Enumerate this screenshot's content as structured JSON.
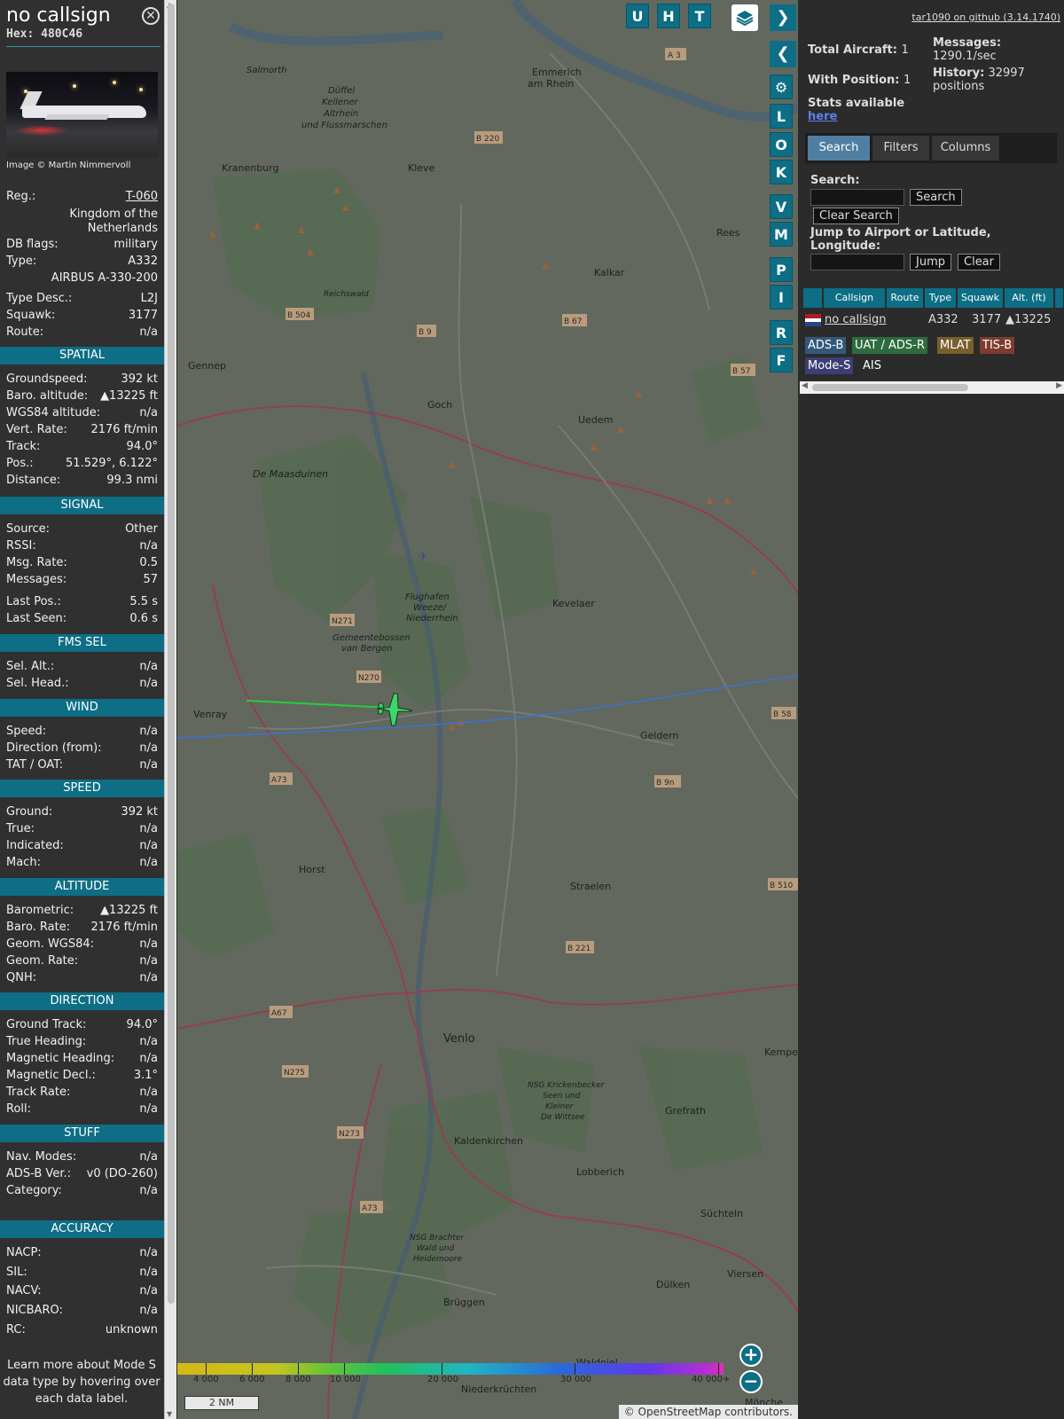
{
  "info": {
    "callsign": "no callsign",
    "hex": "Hex: 480C46",
    "close_icon": "close-icon",
    "photo_credit": "Image © Martin Nimmervoll",
    "header_fields": [
      {
        "label": "Reg.:",
        "value": "T-060"
      },
      {
        "label": "DB flags:",
        "value": "military"
      },
      {
        "label": "Type:",
        "value": "A332"
      },
      {
        "label": "Type Desc.:",
        "value": "L2J"
      },
      {
        "label": "Squawk:",
        "value": "3177"
      },
      {
        "label": "Route:",
        "value": "n/a"
      }
    ],
    "country_line1": "Kingdom of the",
    "country_line2": "Netherlands",
    "type_full": "AIRBUS A-330-200",
    "sections": {
      "spatial": {
        "title": "SPATIAL",
        "rows": [
          {
            "label": "Groundspeed:",
            "value": "392 kt"
          },
          {
            "label": "Baro. altitude:",
            "value": "▲13225 ft"
          },
          {
            "label": "WGS84 altitude:",
            "value": "n/a"
          },
          {
            "label": "Vert. Rate:",
            "value": "2176 ft/min"
          },
          {
            "label": "Track:",
            "value": "94.0°"
          },
          {
            "label": "Pos.:",
            "value": "51.529°, 6.122°"
          },
          {
            "label": "Distance:",
            "value": "99.3 nmi"
          }
        ]
      },
      "signal": {
        "title": "SIGNAL",
        "rows": [
          {
            "label": "Source:",
            "value": "Other"
          },
          {
            "label": "RSSI:",
            "value": "n/a"
          },
          {
            "label": "Msg. Rate:",
            "value": "0.5"
          },
          {
            "label": "Messages:",
            "value": "57"
          },
          {
            "label": "Last Pos.:",
            "value": "5.5 s"
          },
          {
            "label": "Last Seen:",
            "value": "0.6 s"
          }
        ]
      },
      "fms": {
        "title": "FMS SEL",
        "rows": [
          {
            "label": "Sel. Alt.:",
            "value": "n/a"
          },
          {
            "label": "Sel. Head.:",
            "value": "n/a"
          }
        ]
      },
      "wind": {
        "title": "WIND",
        "rows": [
          {
            "label": "Speed:",
            "value": "n/a"
          },
          {
            "label": "Direction (from):",
            "value": "n/a"
          },
          {
            "label": "TAT / OAT:",
            "value": "n/a"
          }
        ]
      },
      "speed": {
        "title": "SPEED",
        "rows": [
          {
            "label": "Ground:",
            "value": "392 kt"
          },
          {
            "label": "True:",
            "value": "n/a"
          },
          {
            "label": "Indicated:",
            "value": "n/a"
          },
          {
            "label": "Mach:",
            "value": "n/a"
          }
        ]
      },
      "altitude": {
        "title": "ALTITUDE",
        "rows": [
          {
            "label": "Barometric:",
            "value": "▲13225 ft"
          },
          {
            "label": "Baro. Rate:",
            "value": "2176 ft/min"
          },
          {
            "label": "Geom. WGS84:",
            "value": "n/a"
          },
          {
            "label": "Geom. Rate:",
            "value": "n/a"
          },
          {
            "label": "QNH:",
            "value": "n/a"
          }
        ]
      },
      "direction": {
        "title": "DIRECTION",
        "rows": [
          {
            "label": "Ground Track:",
            "value": "94.0°"
          },
          {
            "label": "True Heading:",
            "value": "n/a"
          },
          {
            "label": "Magnetic Heading:",
            "value": "n/a"
          },
          {
            "label": "Magnetic Decl.:",
            "value": "3.1°"
          },
          {
            "label": "Track Rate:",
            "value": "n/a"
          },
          {
            "label": "Roll:",
            "value": "n/a"
          }
        ]
      },
      "stuff": {
        "title": "STUFF",
        "rows": [
          {
            "label": "Nav. Modes:",
            "value": "n/a"
          },
          {
            "label": "ADS-B Ver.:",
            "value": "v0 (DO-260)"
          },
          {
            "label": "Category:",
            "value": "n/a"
          }
        ]
      },
      "accuracy": {
        "title": "ACCURACY",
        "rows": [
          {
            "label": "NACP:",
            "value": "n/a"
          },
          {
            "label": "SIL:",
            "value": "n/a"
          },
          {
            "label": "NACV:",
            "value": "n/a"
          },
          {
            "label": "NICBARO:",
            "value": "n/a"
          },
          {
            "label": "RC:",
            "value": "unknown"
          }
        ]
      }
    },
    "footnote": "Learn more about Mode S data type by hovering over each data label."
  },
  "map": {
    "buttons_top": [
      "U",
      "H",
      "T"
    ],
    "buttons_side": [
      "L",
      "O",
      "K",
      "V",
      "M",
      "P",
      "I",
      "R",
      "F"
    ],
    "layers_icon": "layers-icon",
    "settings_icon": "gear-icon",
    "expand_icon": "chevron-right-icon",
    "collapse_icon": "chevron-left-icon",
    "toggle_icon": "split-arrows-icon",
    "zoom_in": "+",
    "zoom_out": "−",
    "scale": "2 NM",
    "attribution": "© OpenStreetMap contributors.",
    "altitude_labels": [
      "4 000",
      "6 000",
      "8 000",
      "10 000",
      "20 000",
      "30 000",
      "40 000+"
    ],
    "places": [
      "Emmerich am Rhein",
      "Kleve",
      "Kranenburg",
      "Kalkar",
      "Goch",
      "Uedem",
      "Gennep",
      "Kevelaer",
      "Venray",
      "Geldern",
      "Horst",
      "Straelen",
      "Venlo",
      "Kaldenkirchen",
      "Grefrath",
      "Lobberich",
      "Süchteln",
      "Brüggen",
      "Dülken",
      "Viersen",
      "Kempen",
      "Rees",
      "Niederkrüchten",
      "Waldniel",
      "Flughafen Weeze/ Niederrhein",
      "De Maasduinen",
      "Reichswald",
      "Salmorth",
      "Düffel Kellener Altrhein und Flussmarschen",
      "Gemeentebossen van Bergen",
      "NSG Krickenbecker Seen und Kleiner De Wittsee",
      "NSG Brachter Wald und Heidemoore",
      "Mönche"
    ],
    "road_labels": [
      "A 3",
      "B 220",
      "B 504",
      "B 9",
      "B 67",
      "B 57",
      "N271",
      "N270",
      "B 58",
      "A73",
      "B 9n",
      "B 510",
      "B 221",
      "A67",
      "N275",
      "N273",
      "A73"
    ],
    "colors": {
      "accent": "#0d6e85",
      "trail_green": "#23d13a",
      "trail_blue": "#3a73d6",
      "aircraft": "#41d46c"
    }
  },
  "side": {
    "github_link": "tar1090 on github (3.14.1740)",
    "total_aircraft_label": "Total Aircraft:",
    "total_aircraft": "1",
    "with_position_label": "With Position:",
    "with_position": "1",
    "messages_label": "Messages:",
    "messages_value": "1290.1/sec",
    "history_label": "History:",
    "history_value": "32997",
    "history_unit": "positions",
    "stats_label": "Stats available",
    "stats_link": "here",
    "tabs": [
      "Search",
      "Filters",
      "Columns"
    ],
    "search_label": "Search:",
    "search_button": "Search",
    "clear_search_button": "Clear Search",
    "jump_label_1": "Jump to Airport or Latitude,",
    "jump_label_2": "Longitude:",
    "jump_button": "Jump",
    "clear_button": "Clear",
    "table": {
      "headers": [
        "Callsign",
        "Route",
        "Type",
        "Squawk",
        "Alt. (ft)"
      ],
      "rows": [
        {
          "flag": "netherlands-flag-icon",
          "callsign": "no callsign",
          "route": "",
          "type": "A332",
          "squawk": "3177",
          "alt": "▲13225"
        }
      ]
    },
    "sources": [
      {
        "label": "ADS-B",
        "color": "#34587a"
      },
      {
        "label": "UAT / ADS-R",
        "color": "#2e6b3f"
      },
      {
        "label": "MLAT",
        "color": "#7a5f2c"
      },
      {
        "label": "TIS-B",
        "color": "#7f3b2f"
      },
      {
        "label": "Mode-S",
        "color": "#3c3f74"
      },
      {
        "label": "AIS",
        "color": ""
      }
    ]
  }
}
